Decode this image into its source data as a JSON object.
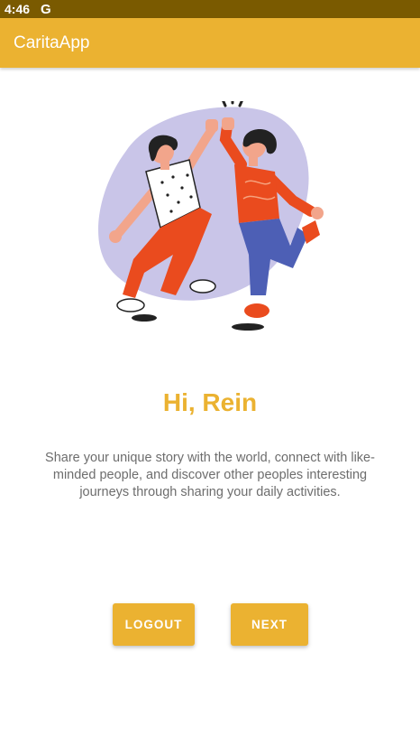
{
  "status_bar": {
    "time": "4:46",
    "notification_glyph": "G",
    "background_color": "#7a5a00"
  },
  "app_bar": {
    "title": "CaritaApp",
    "background_color": "#ebb231"
  },
  "illustration": {
    "icon": "high-five-illustration",
    "blob_color": "#c9c5e8"
  },
  "main": {
    "greeting": "Hi, Rein",
    "description": "Share your unique story with the world, connect with like-minded people, and discover other peoples interesting journeys through sharing your daily activities.",
    "accent_color": "#ebb231"
  },
  "actions": {
    "logout_label": "LOGOUT",
    "next_label": "NEXT"
  }
}
